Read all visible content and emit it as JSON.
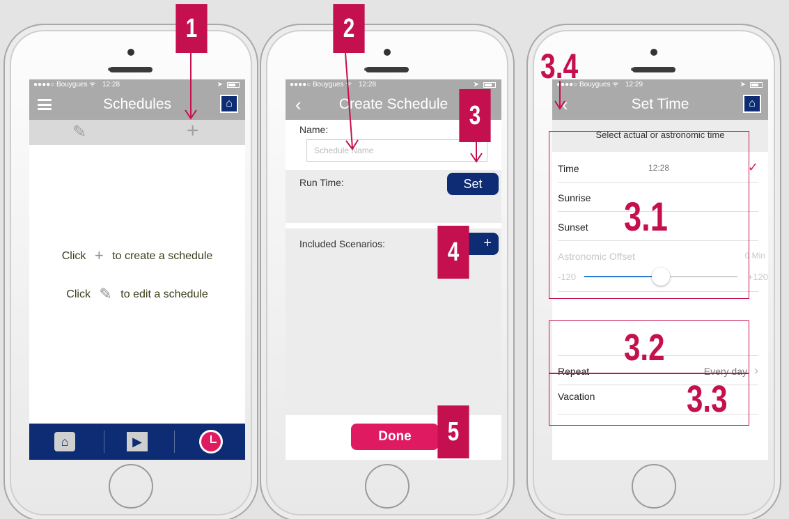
{
  "colors": {
    "accent": "#e01a60",
    "annotation": "#c4104f",
    "navy": "#0d2c74",
    "navbar": "#aaaaaa"
  },
  "screen1": {
    "status": {
      "carrier": "●●●●○ Bouygues ᯤ",
      "time": "12:28",
      "location": "➤"
    },
    "title": "Schedules",
    "home_icon": "home-icon",
    "toolbar": {
      "edit_icon": "✎",
      "add_icon": "+"
    },
    "hint_create": {
      "prefix": "Click",
      "icon": "+",
      "suffix": "to create a schedule"
    },
    "hint_edit": {
      "prefix": "Click",
      "icon": "✎",
      "suffix": "to edit a schedule"
    },
    "tabs": {
      "home": "⌂",
      "play": "▶"
    }
  },
  "screen2": {
    "status": {
      "carrier": "●●●●○ Bouygues ᯤ",
      "time": "12:28",
      "location": "➤"
    },
    "back": "‹",
    "title": "Create Schedule",
    "name_label": "Name:",
    "name_placeholder": "Schedule Name",
    "run_time_label": "Run Time:",
    "set_button": "Set",
    "scenarios_label": "Included Scenarios:",
    "add_button": "+",
    "done_button": "Done"
  },
  "screen3": {
    "status": {
      "carrier": "●●●●○ Bouygues ᯤ",
      "time": "12:29",
      "location": "➤"
    },
    "back": "‹",
    "title": "Set Time",
    "subheader": "Select actual or astronomic time",
    "rows": [
      {
        "label": "Time",
        "value": "12:28",
        "checked": "✓"
      },
      {
        "label": "Sunrise"
      },
      {
        "label": "Sunset"
      }
    ],
    "offset_label": "Astronomic Offset",
    "offset_value": "0 Min",
    "slider_min": "-120",
    "slider_max": "+120",
    "slider_level": 0.5,
    "repeat_label": "Repeat",
    "repeat_value": "Every day",
    "repeat_chevron": "›",
    "vacation_label": "Vacation"
  },
  "annotations": {
    "b1": "1",
    "b2": "2",
    "b3": "3",
    "b4": "4",
    "b5": "5",
    "l31": "3.1",
    "l32": "3.2",
    "l33": "3.3",
    "l34": "3.4"
  }
}
